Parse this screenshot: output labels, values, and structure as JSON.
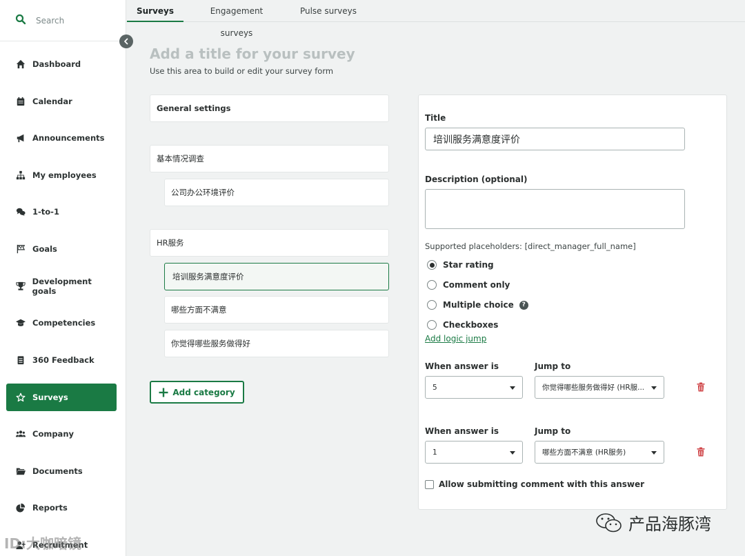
{
  "sidebar": {
    "search_placeholder": "Search",
    "items": [
      {
        "label": "Dashboard",
        "icon": "home-icon"
      },
      {
        "label": "Calendar",
        "icon": "calendar-icon"
      },
      {
        "label": "Announcements",
        "icon": "megaphone-icon"
      },
      {
        "label": "My employees",
        "icon": "org-chart-icon"
      },
      {
        "label": "1-to-1",
        "icon": "chat-bubbles-icon"
      },
      {
        "label": "Goals",
        "icon": "flag-icon"
      },
      {
        "label": "Development goals",
        "icon": "trophy-icon"
      },
      {
        "label": "Competencies",
        "icon": "graduation-cap-icon"
      },
      {
        "label": "360 Feedback",
        "icon": "clipboard-icon"
      },
      {
        "label": "Surveys",
        "icon": "star-icon",
        "active": true
      },
      {
        "label": "Company",
        "icon": "people-icon"
      },
      {
        "label": "Documents",
        "icon": "folder-icon"
      },
      {
        "label": "Reports",
        "icon": "pie-chart-icon"
      },
      {
        "label": "Recruitment",
        "icon": "add-user-icon"
      }
    ]
  },
  "tabs": [
    {
      "label": "Surveys",
      "active": true
    },
    {
      "label": "Engagement surveys"
    },
    {
      "label": "Pulse surveys"
    }
  ],
  "editor": {
    "title_placeholder": "Add a title for your survey",
    "subtitle": "Use this area to build or edit your survey form"
  },
  "structure": {
    "general_settings": "General settings",
    "categories": [
      {
        "label": "基本情况调查",
        "questions": [
          "公司办公环境评价"
        ]
      },
      {
        "label": "HR服务",
        "questions": [
          "培训服务满意度评价",
          "哪些方面不满意",
          "你觉得哪些服务做得好"
        ]
      }
    ],
    "add_category_label": "Add category"
  },
  "question_panel": {
    "title_label": "Title",
    "title_value": "培训服务满意度评价",
    "description_label": "Description (optional)",
    "description_value": "",
    "placeholders_hint": "Supported placeholders: [direct_manager_full_name]",
    "answer_types": [
      {
        "label": "Star rating",
        "selected": true
      },
      {
        "label": "Comment only",
        "selected": false
      },
      {
        "label": "Multiple choice",
        "selected": false,
        "help": true
      },
      {
        "label": "Checkboxes",
        "selected": false
      }
    ],
    "help_symbol": "?",
    "add_logic_jump": "Add logic jump",
    "logic_jumps": [
      {
        "when_label": "When answer is",
        "when_value": "5",
        "jump_label": "Jump to",
        "jump_value": "你觉得哪些服务做得好 (HR服..."
      },
      {
        "when_label": "When answer is",
        "when_value": "1",
        "jump_label": "Jump to",
        "jump_value": "哪些方面不满意 (HR服务)"
      }
    ],
    "allow_comment_label": "Allow submitting comment with this answer"
  },
  "watermarks": {
    "wechat_account": "产品海豚湾",
    "corner_text": "ID:大咖暗镜"
  },
  "colors": {
    "accent": "#1a7a44",
    "danger": "#d0474a"
  }
}
